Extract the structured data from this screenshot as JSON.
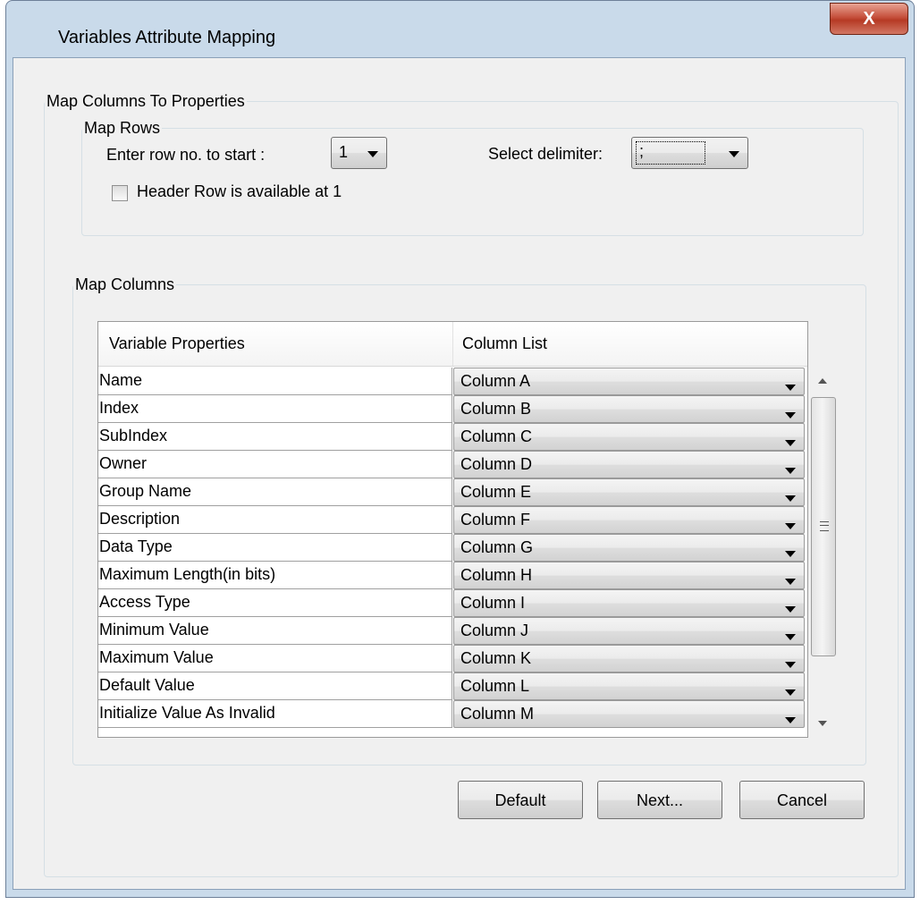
{
  "window": {
    "title": "Variables Attribute Mapping",
    "close_label": "X"
  },
  "map_columns_to_properties": {
    "legend": "Map Columns To Properties"
  },
  "map_rows": {
    "legend": "Map Rows",
    "start_row_label": "Enter row no. to start :",
    "start_row_value": "1",
    "delimiter_label": "Select delimiter:",
    "delimiter_value": ";",
    "header_row_label": "Header Row is available at 1",
    "header_row_checked": false
  },
  "map_columns": {
    "legend": "Map Columns",
    "headers": [
      "Variable Properties",
      "Column List"
    ],
    "rows": [
      {
        "property": "Name",
        "column": "Column A"
      },
      {
        "property": "Index",
        "column": "Column B"
      },
      {
        "property": "SubIndex",
        "column": "Column C"
      },
      {
        "property": "Owner",
        "column": "Column D"
      },
      {
        "property": "Group Name",
        "column": "Column E"
      },
      {
        "property": "Description",
        "column": "Column F"
      },
      {
        "property": "Data Type",
        "column": "Column G"
      },
      {
        "property": "Maximum Length(in bits)",
        "column": "Column H"
      },
      {
        "property": "Access Type",
        "column": "Column I"
      },
      {
        "property": "Minimum Value",
        "column": "Column J"
      },
      {
        "property": "Maximum Value",
        "column": "Column K"
      },
      {
        "property": "Default Value",
        "column": "Column L"
      },
      {
        "property": "Initialize Value As Invalid",
        "column": "Column M"
      }
    ]
  },
  "buttons": {
    "default_label": "Default",
    "next_label": "Next...",
    "cancel_label": "Cancel"
  },
  "colors": {
    "frame": "#c9daea",
    "client_background": "#f0f0f0",
    "close_button": "#c5503b"
  }
}
